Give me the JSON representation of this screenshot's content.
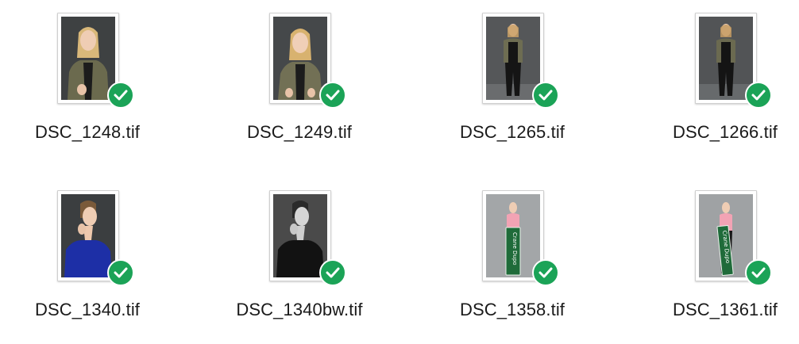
{
  "files": [
    {
      "name": "DSC_1248.tif",
      "status_icon": "checkmark-synced-icon",
      "status_color": "#1ba357"
    },
    {
      "name": "DSC_1249.tif",
      "status_icon": "checkmark-synced-icon",
      "status_color": "#1ba357"
    },
    {
      "name": "DSC_1265.tif",
      "status_icon": "checkmark-synced-icon",
      "status_color": "#1ba357"
    },
    {
      "name": "DSC_1266.tif",
      "status_icon": "checkmark-synced-icon",
      "status_color": "#1ba357"
    },
    {
      "name": "DSC_1340.tif",
      "status_icon": "checkmark-synced-icon",
      "status_color": "#1ba357"
    },
    {
      "name": "DSC_1340bw.tif",
      "status_icon": "checkmark-synced-icon",
      "status_color": "#1ba357"
    },
    {
      "name": "DSC_1358.tif",
      "status_icon": "checkmark-synced-icon",
      "status_color": "#1ba357"
    },
    {
      "name": "DSC_1361.tif",
      "status_icon": "checkmark-synced-icon",
      "status_color": "#1ba357"
    }
  ],
  "signs": {
    "sign_1358": "Crane Dupo",
    "sign_1361": "Crane Dupo"
  }
}
